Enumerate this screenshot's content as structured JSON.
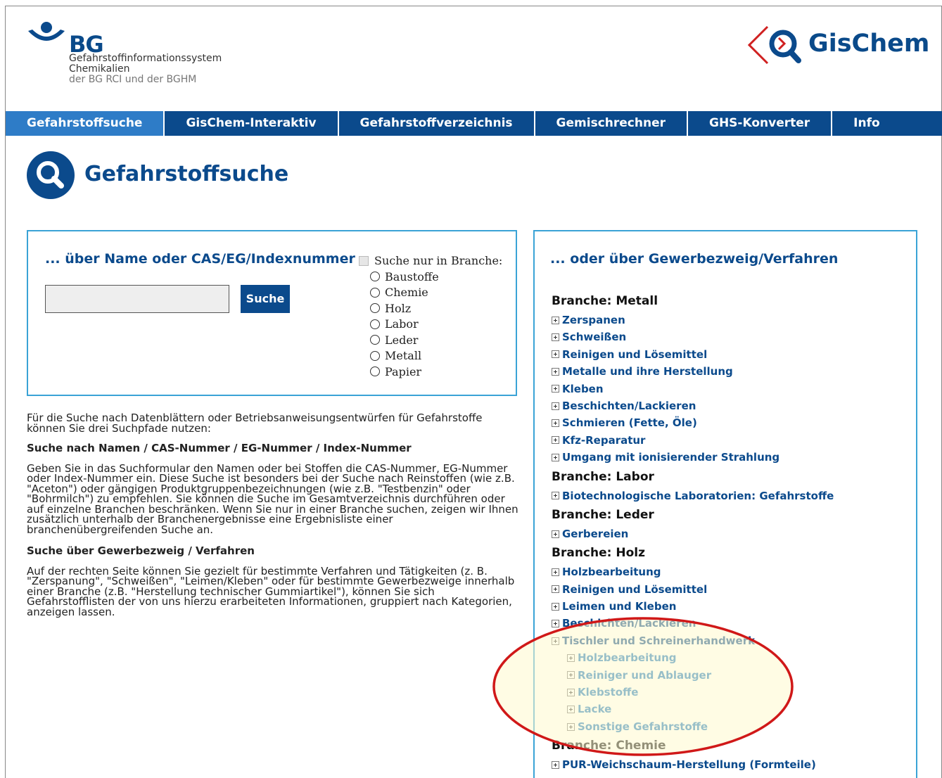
{
  "header": {
    "bg_logo_text": "BG",
    "bg_sub_line1": "Gefahrstoffinformationssystem",
    "bg_sub_line2": "Chemikalien",
    "bg_sub_line3": "der BG RCI und der BGHM",
    "gischem_logo_text": "GisChem"
  },
  "nav": {
    "tabs": [
      {
        "label": "Gefahrstoffsuche",
        "active": true
      },
      {
        "label": "GisChem-Interaktiv"
      },
      {
        "label": "Gefahrstoffverzeichnis"
      },
      {
        "label": "Gemischrechner"
      },
      {
        "label": "GHS-Konverter"
      },
      {
        "label": "Info"
      }
    ]
  },
  "page": {
    "title": "Gefahrstoffsuche"
  },
  "search": {
    "heading": "... über Name oder CAS/EG/Indexnummer",
    "input_value": "",
    "button_label": "Suche",
    "branch_checkbox_label": "Suche nur in Branche:",
    "branches": [
      "Baustoffe",
      "Chemie",
      "Holz",
      "Labor",
      "Leder",
      "Metall",
      "Papier"
    ]
  },
  "info": {
    "intro": "Für die Suche nach Datenblättern oder Betriebsanweisungsentwürfen für Gefahrstoffe können Sie drei Suchpfade nutzen:",
    "h1": "Suche nach Namen / CAS-Nummer / EG-Nummer / Index-Nummer",
    "p1": "Geben Sie in das Suchformular den Namen oder bei Stoffen die CAS-Nummer, EG-Nummer oder Index-Nummer ein. Diese Suche ist besonders bei der Suche nach Reinstoffen (wie z.B. \"Aceton\") oder gängigen Produktgruppenbezeichnungen (wie z.B. \"Testbenzin\" oder \"Bohrmilch\") zu empfehlen. Sie können die Suche im Gesamtverzeichnis durchführen oder auf einzelne Branchen beschränken. Wenn Sie nur in einer Branche suchen, zeigen wir Ihnen zusätzlich unterhalb der Branchenergebnisse eine Ergebnisliste einer branchenübergreifenden Suche an.",
    "h2": "Suche über Gewerbezweig / Verfahren",
    "p2": "Auf der rechten Seite können Sie gezielt für bestimmte Verfahren und Tätigkeiten (z. B. \"Zerspanung\", \"Schweißen\", \"Leimen/Kleben\" oder für bestimmte Gewerbezweige innerhalb einer Branche (z.B. \"Herstellung technischer Gummiartikel\"), können Sie sich Gefahrstofflisten der von uns hierzu erarbeiteten Informationen, gruppiert nach Kategorien, anzeigen lassen."
  },
  "right": {
    "heading": "... oder über Gewerbezweig/Verfahren",
    "metall": {
      "title": "Branche: Metall",
      "items": [
        "Zerspanen",
        "Schweißen",
        "Reinigen und Lösemittel",
        "Metalle und ihre Herstellung",
        "Kleben",
        "Beschichten/Lackieren",
        "Schmieren (Fette, Öle)",
        "Kfz-Reparatur",
        "Umgang mit ionisierender Strahlung"
      ]
    },
    "labor": {
      "title": "Branche: Labor",
      "items": [
        "Biotechnologische Laboratorien: Gefahrstoffe"
      ]
    },
    "leder": {
      "title": "Branche: Leder",
      "items": [
        "Gerbereien"
      ]
    },
    "holz": {
      "title": "Branche: Holz",
      "items": [
        "Holzbearbeitung",
        "Reinigen und Lösemittel",
        "Leimen und Kleben",
        "Beschichten/Lackieren",
        "Tischler und Schreinerhandwerk"
      ],
      "subitems": [
        "Holzbearbeitung",
        "Reiniger und Ablauger",
        "Klebstoffe",
        "Lacke",
        "Sonstige Gefahrstoffe"
      ]
    },
    "chemie": {
      "title": "Branche: Chemie",
      "items": [
        "PUR-Weichschaum-Herstellung (Formteile)"
      ]
    }
  },
  "colors": {
    "brand_blue": "#0b4a8c",
    "active_tab": "#2e7cc7",
    "box_border": "#3aa3d6",
    "highlight": "#d01818"
  }
}
